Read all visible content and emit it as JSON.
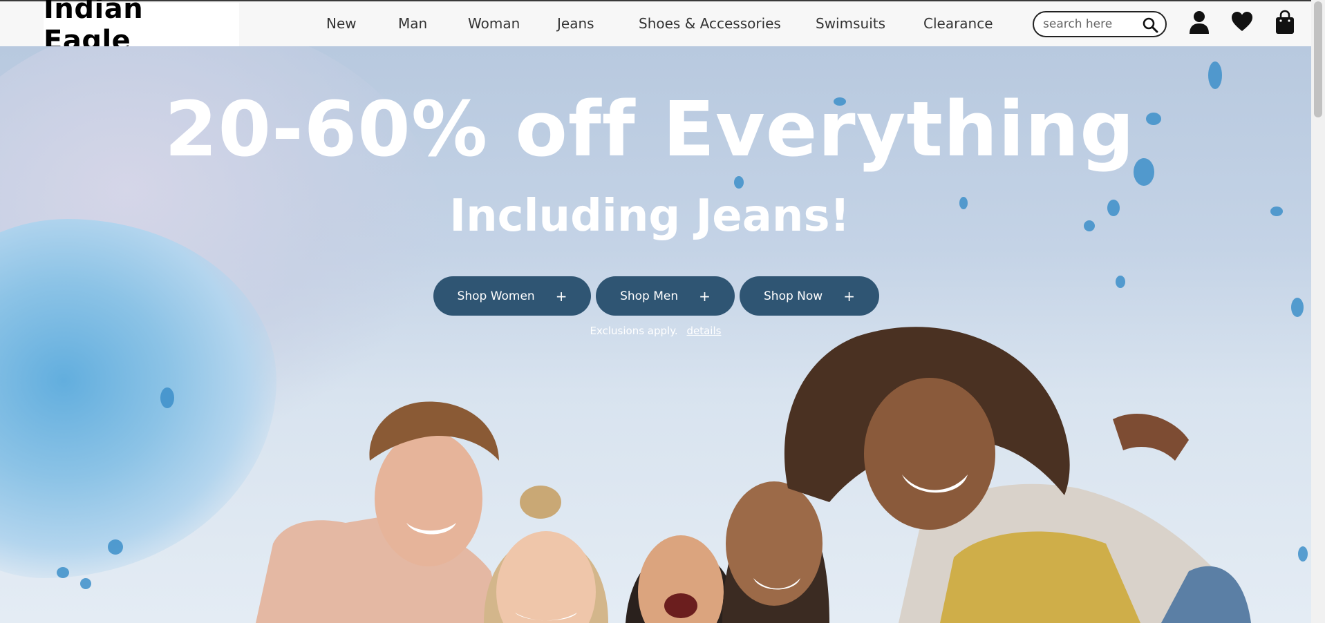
{
  "header": {
    "logo": "Indian Eagle",
    "nav": [
      "New",
      "Man",
      "Woman",
      "Jeans",
      "Shoes & Accessories",
      "Swimsuits",
      "Clearance"
    ],
    "search_placeholder": "search here",
    "icons": [
      "search-icon",
      "account-icon",
      "heart-icon",
      "shopping-bag-icon"
    ]
  },
  "hero": {
    "headline": "20-60% off Everything",
    "subhead": "Including Jeans!",
    "buttons": [
      "Shop Women",
      "Shop Men",
      "Shop Now"
    ],
    "button_suffix": "+",
    "exclusions_text": "Exclusions apply.",
    "details_link": "details"
  },
  "colors": {
    "button_bg": "#2f5573",
    "hero_sky": "#c4d3e6",
    "text_white": "#ffffff"
  }
}
